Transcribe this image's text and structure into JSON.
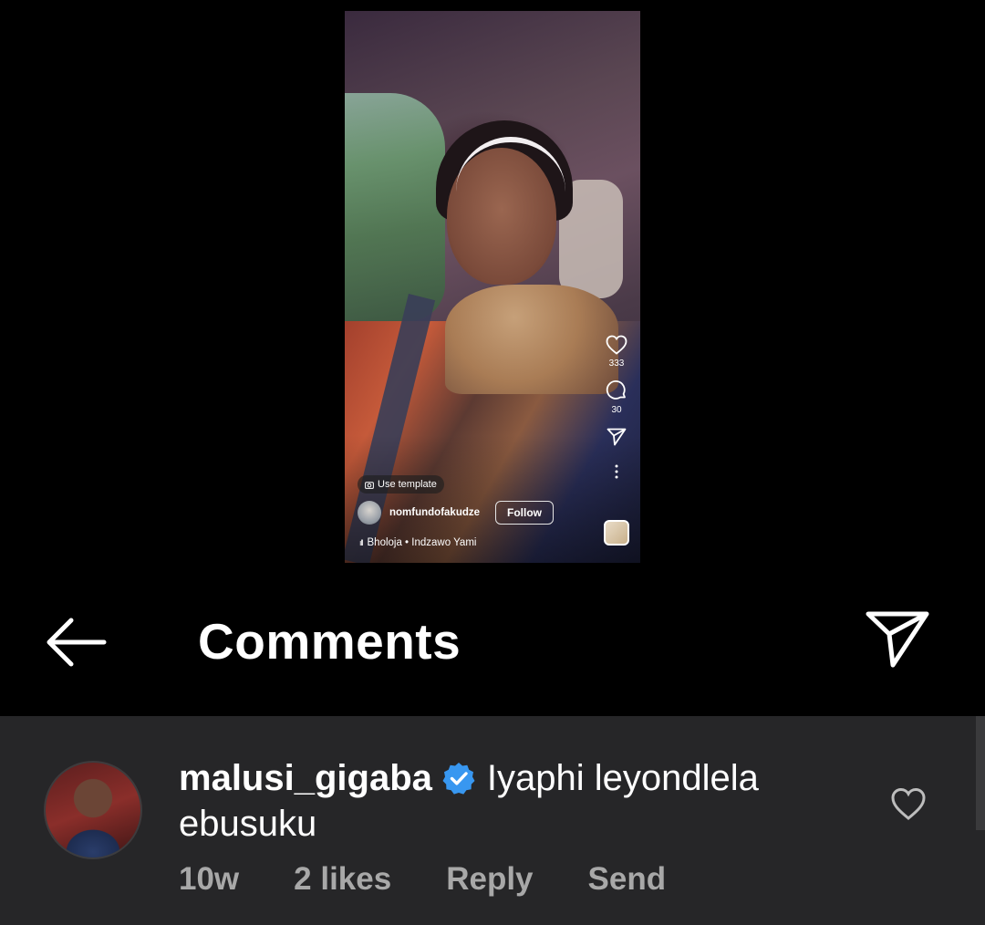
{
  "reel": {
    "use_template_label": "Use template",
    "username": "nomfundofakudze",
    "follow_label": "Follow",
    "audio_artist": "Bholoja",
    "audio_track": "Indzawo Yami",
    "audio_label": "Bholoja • Indzawo Yami",
    "likes": "333",
    "comments": "30"
  },
  "header": {
    "title": "Comments"
  },
  "comment": {
    "username": "malusi_gigaba",
    "verified": true,
    "text": "Iyaphi leyondlela ebusuku",
    "time": "10w",
    "likes_label": "2 likes",
    "reply_label": "Reply",
    "send_label": "Send"
  },
  "colors": {
    "background": "#000000",
    "comment_panel": "#262628",
    "verified_badge": "#3897f0",
    "meta_text": "#a8a8a8"
  }
}
